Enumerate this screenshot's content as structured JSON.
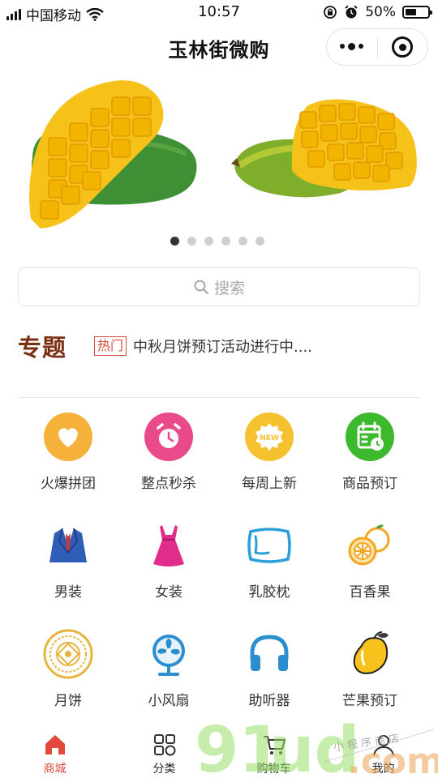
{
  "status_bar": {
    "carrier": "中国移动",
    "time": "10:57",
    "battery": "50%",
    "battery_level": 0.5
  },
  "nav": {
    "title": "玉林街微购",
    "more_icon": "more-dots-icon",
    "close_icon": "target-icon"
  },
  "banner": {
    "slide_count": 6,
    "active_index": 0
  },
  "search": {
    "placeholder": "搜索",
    "icon": "search-icon"
  },
  "topic": {
    "title": "专题",
    "tag": "热门",
    "text": "中秋月饼预订活动进行中...."
  },
  "categories": [
    {
      "label": "火爆拼团",
      "icon": "heart-icon",
      "color": "#F6B13B"
    },
    {
      "label": "整点秒杀",
      "icon": "alarm-clock-icon",
      "color": "#E84A8A"
    },
    {
      "label": "每周上新",
      "icon": "new-badge-icon",
      "color": "#F6C12E"
    },
    {
      "label": "商品预订",
      "icon": "calendar-icon",
      "color": "#3DB92E"
    },
    {
      "label": "男装",
      "icon": "suit-icon",
      "color": "#2F5DB8"
    },
    {
      "label": "女装",
      "icon": "dress-icon",
      "color": "#E02D8C"
    },
    {
      "label": "乳胶枕",
      "icon": "pillow-icon",
      "color": "#2B9FD9"
    },
    {
      "label": "百香果",
      "icon": "passion-fruit-icon",
      "color": "#F5A623"
    },
    {
      "label": "月饼",
      "icon": "mooncake-icon",
      "color": "#E8B33F"
    },
    {
      "label": "小风扇",
      "icon": "fan-icon",
      "color": "#2B8FCF"
    },
    {
      "label": "助听器",
      "icon": "headphones-icon",
      "color": "#2B8FCF"
    },
    {
      "label": "芒果预订",
      "icon": "mango-icon",
      "color": "#F7C21B"
    }
  ],
  "tabbar": [
    {
      "label": "商城",
      "icon": "home-icon",
      "active": true
    },
    {
      "label": "分类",
      "icon": "grid-icon",
      "active": false
    },
    {
      "label": "购物车",
      "icon": "cart-icon",
      "active": false
    },
    {
      "label": "我的",
      "icon": "user-icon",
      "active": false
    }
  ],
  "colors": {
    "accent": "#E0493C",
    "topic_title": "#7A2E12"
  },
  "watermark": {
    "text": "91ud.com",
    "handwriting": "小程序商店"
  }
}
